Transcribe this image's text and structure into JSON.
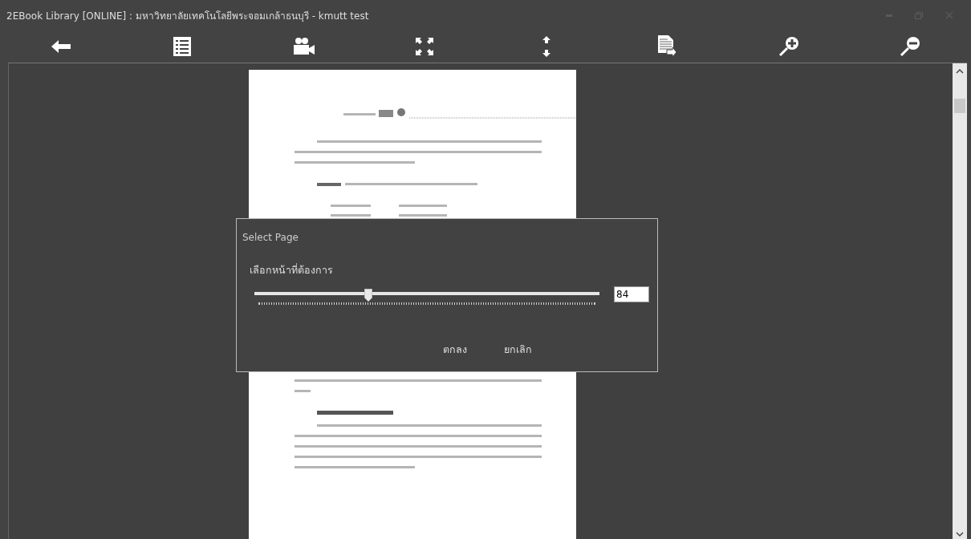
{
  "window": {
    "title": "2EBook Library [ONLINE] : มหาวิทยาลัยเทคโนโลยีพระจอมเกล้าธนบุรี  - kmutt test"
  },
  "dialog": {
    "title": "Select Page",
    "label": "เลือกหน้าที่ต้องการ",
    "slider": {
      "level": 0.33
    },
    "page_field": {
      "value": "84"
    },
    "buttons": [
      "ตกลง",
      "ยกเลิก"
    ]
  }
}
